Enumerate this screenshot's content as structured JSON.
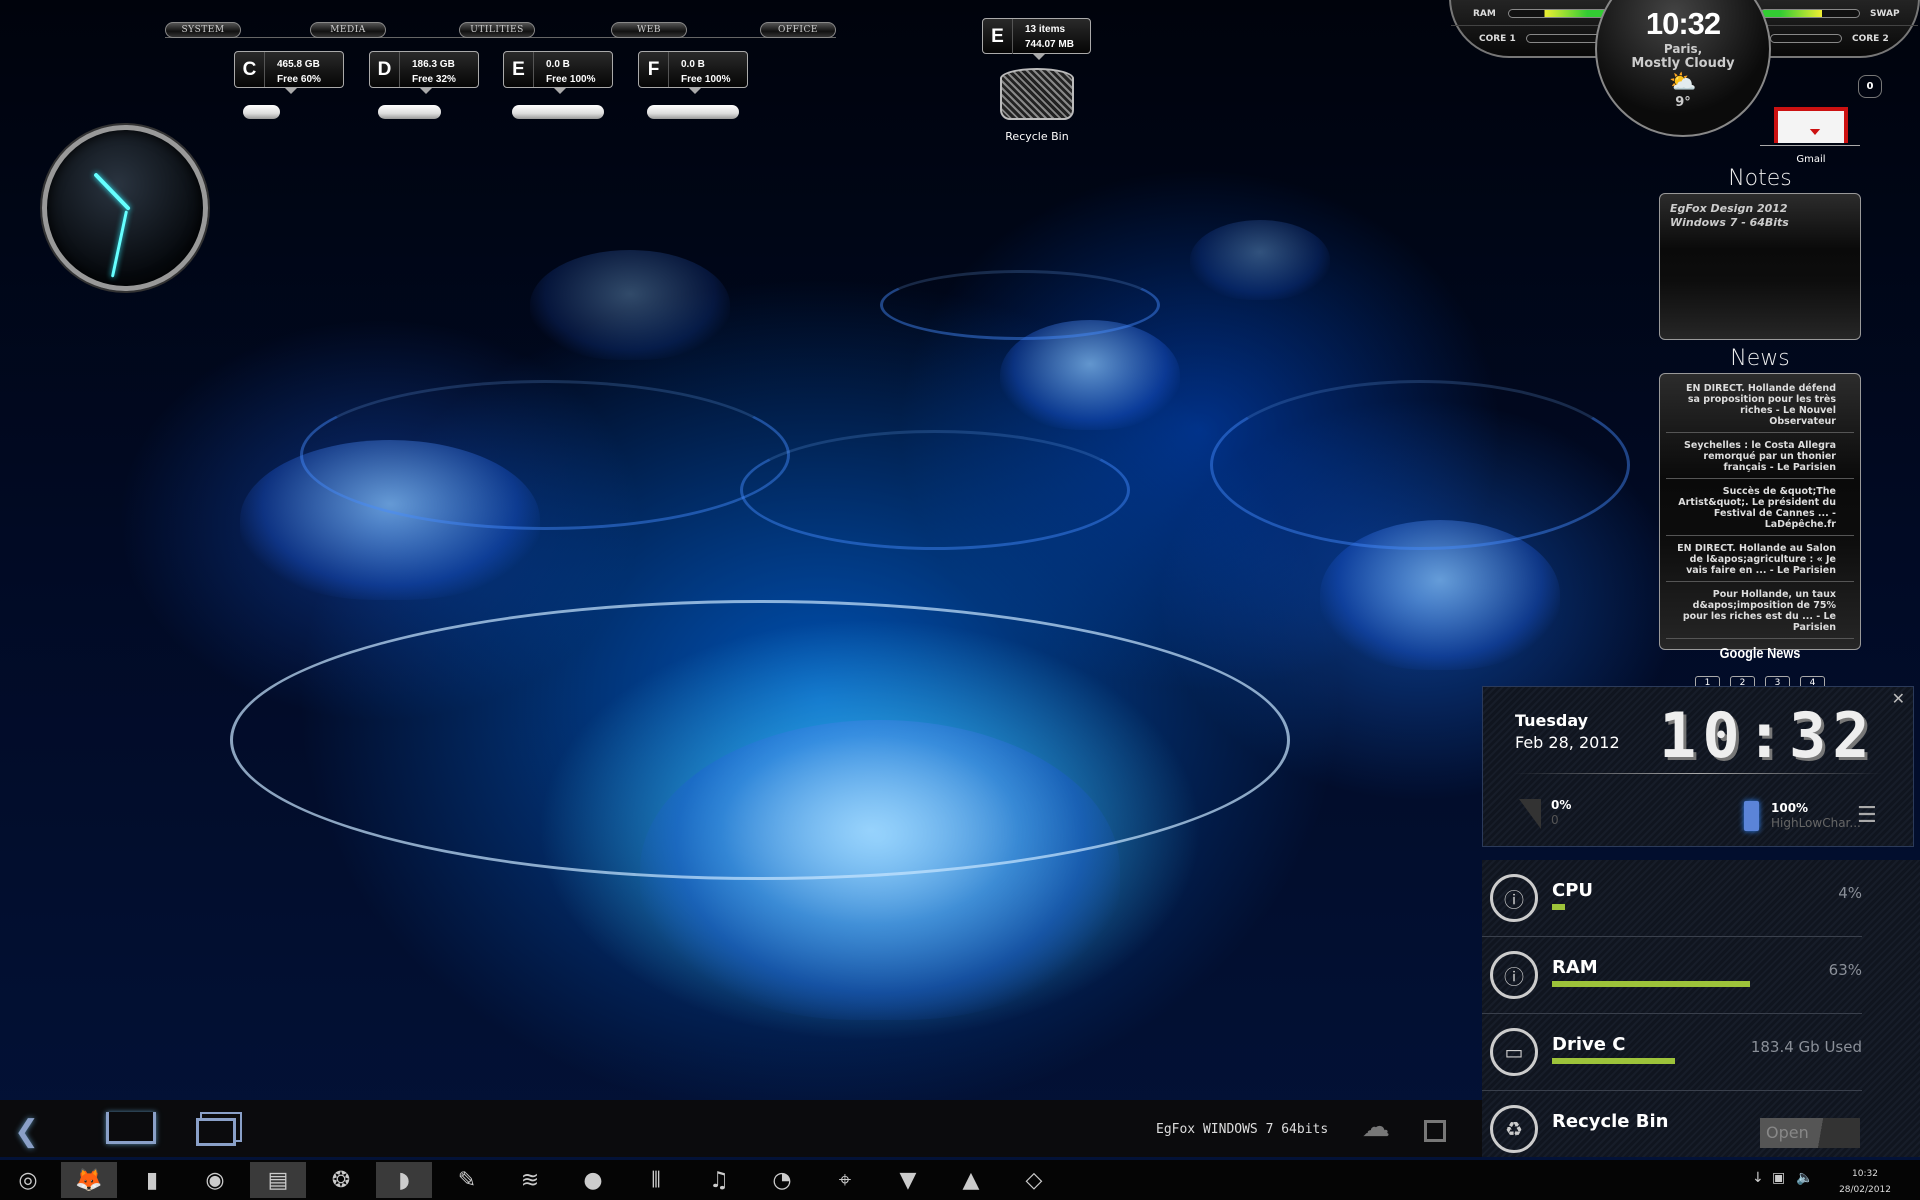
{
  "menu_tabs": [
    "System",
    "Media",
    "Utilities",
    "Web",
    "Office"
  ],
  "drives": [
    {
      "letter": "C",
      "size": "465.8 GB",
      "free": "Free 60%",
      "used_fraction": 0.4
    },
    {
      "letter": "D",
      "size": "186.3 GB",
      "free": "Free 32%",
      "used_fraction": 0.68
    },
    {
      "letter": "E",
      "size": "0.0 B",
      "free": "Free 100%",
      "used_fraction": 1.0
    },
    {
      "letter": "F",
      "size": "0.0 B",
      "free": "Free 100%",
      "used_fraction": 1.0
    }
  ],
  "analog_clock": {
    "hour": 10,
    "minute": 32
  },
  "recycle_widget": {
    "drive": "E",
    "items": "13 items",
    "size": "744.07 MB",
    "label": "Recycle Bin"
  },
  "system_gauge": {
    "ram_label": "RAM",
    "swap_label": "SWAP",
    "core1_label": "CORE 1",
    "core2_label": "CORE 2"
  },
  "weather": {
    "time": "10:32",
    "city": "Paris,",
    "condition": "Mostly Cloudy",
    "temp": "9°",
    "icon": "partly-cloudy-icon"
  },
  "gmail": {
    "count": "0",
    "label": "Gmail"
  },
  "notes": {
    "title": "Notes",
    "lines": [
      "EgFox Design 2012",
      "Windows 7 - 64Bits"
    ]
  },
  "news": {
    "title": "News",
    "items": [
      "EN DIRECT. Hollande défend sa proposition pour les très riches - Le Nouvel Observateur",
      "Seychelles : le Costa Allegra remorqué par un thonier français - Le Parisien",
      "Succès de &quot;The Artist&quot;. Le président du Festival de Cannes ... - LaDépêche.fr",
      "EN DIRECT. Hollande au Salon de l&apos;agriculture : « Je vais faire en ... - Le Parisien",
      "Pour Hollande, un taux d&apos;imposition de 75% pour les riches est du ... - Le Parisien"
    ],
    "source": "Google News",
    "pages": [
      "1",
      "2",
      "3",
      "4"
    ]
  },
  "clock_widget": {
    "day": "Tuesday",
    "date": "Feb 28, 2012",
    "time": "10:32",
    "signal_pct": "0%",
    "signal_val": "0",
    "battery_pct": "100%",
    "battery_label": "HighLowChar..."
  },
  "stats": [
    {
      "name": "CPU",
      "value": "4%",
      "fraction": 0.04,
      "icon": "cpu-info-icon"
    },
    {
      "name": "RAM",
      "value": "63%",
      "fraction": 0.63,
      "icon": "ram-info-icon"
    },
    {
      "name": "Drive C",
      "value": "183.4 Gb Used",
      "fraction": 0.39,
      "icon": "hard-drive-icon"
    },
    {
      "name": "Recycle Bin",
      "value": "Open",
      "icon": "recycle-icon"
    }
  ],
  "navbar": {
    "caption": "EgFox WINDOWS 7 64bits"
  },
  "taskbar": {
    "apps": [
      "start",
      "firefox",
      "brush",
      "chrome",
      "file-manager",
      "thunderbird",
      "rainmeter",
      "pen",
      "spotify",
      "coconut",
      "tools",
      "music",
      "paint",
      "satellite",
      "vial",
      "vlc",
      "crystal"
    ],
    "tray_time": "10:32",
    "tray_date": "28/02/2012"
  },
  "colors": {
    "accent_green": "#9dc33a",
    "glow_cyan": "#66ffff"
  }
}
